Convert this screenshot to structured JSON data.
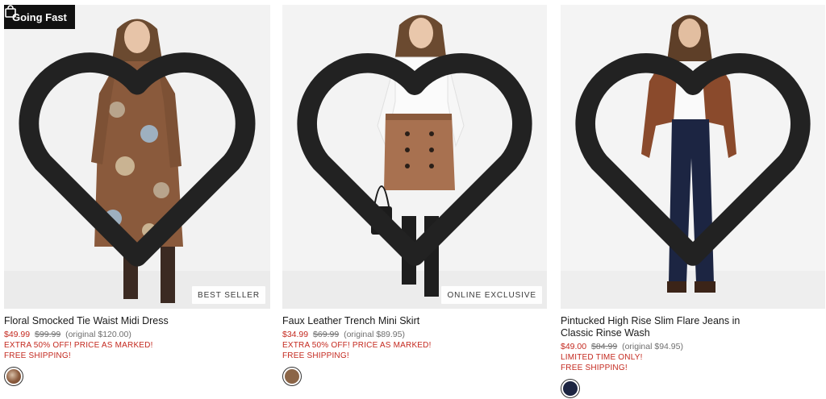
{
  "products": [
    {
      "flag_label": "Going Fast",
      "badge": "BEST SELLER",
      "title": "Floral Smocked Tie Waist Midi Dress",
      "sale_price": "$49.99",
      "was_price": "$99.99",
      "original_price": "(original $120.00)",
      "promo": "EXTRA 50% OFF! PRICE AS MARKED!",
      "shipping": "FREE SHIPPING!",
      "swatch_color": "#8a5a3c",
      "icons": [
        "shopping-bag-icon",
        "heart-icon"
      ]
    },
    {
      "badge": "ONLINE EXCLUSIVE",
      "title": "Faux Leather Trench Mini Skirt",
      "sale_price": "$34.99",
      "was_price": "$69.99",
      "original_price": "(original $89.95)",
      "promo": "EXTRA 50% OFF! PRICE AS MARKED!",
      "shipping": "FREE SHIPPING!",
      "swatch_color": "#8b6547",
      "icons": [
        "heart-icon"
      ]
    },
    {
      "title": "Pintucked High Rise Slim Flare Jeans in Classic Rinse Wash",
      "sale_price": "$49.00",
      "was_price": "$84.99",
      "original_price": "(original $94.95)",
      "promo": "LIMITED TIME ONLY!",
      "shipping": "FREE SHIPPING!",
      "swatch_color": "#1c2542",
      "icons": [
        "heart-icon"
      ]
    }
  ],
  "colors": {
    "sale_red": "#c4291f",
    "flag_bg": "#111111",
    "photo_bg": "#f1f1f1"
  }
}
